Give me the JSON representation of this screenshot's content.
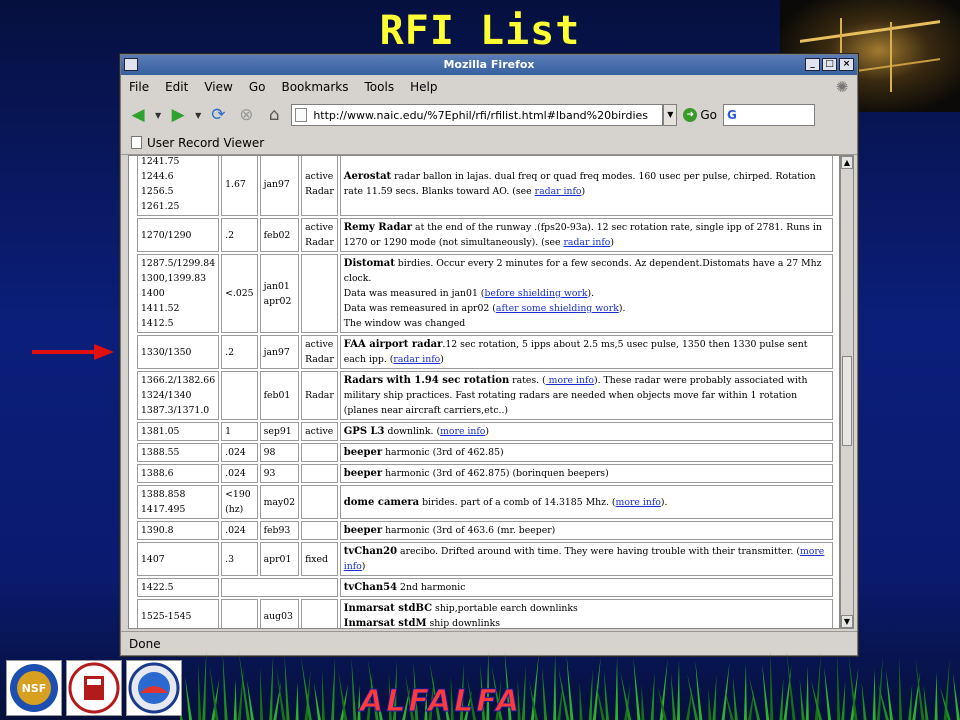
{
  "slide": {
    "title": "RFI List",
    "footer_text": "ALFALFA"
  },
  "window": {
    "title": "Mozilla Firefox"
  },
  "menu": [
    "File",
    "Edit",
    "View",
    "Go",
    "Bookmarks",
    "Tools",
    "Help"
  ],
  "nav": {
    "url": "http://www.naic.edu/%7Ephil/rfi/rfilist.html#lband%20birdies",
    "go_label": "Go",
    "search_value": "G"
  },
  "bookmarks": {
    "item": "User Record Viewer"
  },
  "status": {
    "text": "Done"
  },
  "rows": [
    {
      "freq": [
        "1241.75",
        "1244.6",
        "1256.5",
        "1261.25"
      ],
      "bw": "1.67",
      "date": "jan97",
      "status": [
        "active",
        "Radar"
      ],
      "name": "Aerostat",
      "desc": " radar ballon in lajas. dual freq or quad freq modes. 160 usec per pulse, chirped. Rotation rate 11.59 secs. Blanks toward AO. (see ",
      "link": "radar info",
      "tail": ")"
    },
    {
      "freq": [
        "1270/1290"
      ],
      "bw": ".2",
      "date": "feb02",
      "status": [
        "active",
        "Radar"
      ],
      "name": "Remy Radar",
      "desc": " at the end of the runway .(fps20-93a). 12 sec rotation rate, single ipp of 2781. Runs in 1270 or 1290 mode (not simultaneously). (see ",
      "link": "radar info",
      "tail": ")"
    },
    {
      "freq": [
        "1287.5/1299.84",
        "1300,1399.83",
        "1400",
        "1411.52",
        "1412.5"
      ],
      "bw": "<.025",
      "date": [
        "jan01",
        "apr02"
      ],
      "status": [],
      "name": "Distomat",
      "desc": " birdies. Occur every 2 minutes for a few seconds. Az dependent.Distomats have a 27 Mhz clock.",
      "extra": [
        {
          "pre": "Data was measured in jan01 (",
          "link": "before shielding work",
          "post": ")."
        },
        {
          "pre": "Data was remeasured in apr02 (",
          "link": "after some shielding work",
          "post": ")."
        },
        {
          "pre": "The window was changed",
          "link": "",
          "post": ""
        }
      ]
    },
    {
      "freq": [
        "1330/1350"
      ],
      "bw": ".2",
      "date": "jan97",
      "status": [
        "active",
        "Radar"
      ],
      "name": "FAA airport radar",
      "desc": ".12 sec rotation, 5 ipps about 2.5 ms,5 usec pulse, 1350 then 1330 pulse sent each ipp. (",
      "link": "radar info",
      "tail": ")"
    },
    {
      "freq": [
        "1366.2/1382.66",
        "1324/1340",
        "1387.3/1371.0"
      ],
      "bw": "",
      "date": "feb01",
      "status": [
        "Radar"
      ],
      "name": "Radars with 1.94 sec rotation",
      "desc": " rates. (",
      "link": " more info",
      "tail": "). These radar were probably associated with military ship practices. Fast rotating radars are needed when objects move far within 1 rotation (planes near aircraft carriers,etc..)"
    },
    {
      "freq": [
        "1381.05"
      ],
      "bw": "1",
      "date": "sep91",
      "status": [
        "active"
      ],
      "name": "GPS L3",
      "desc": " downlink. (",
      "link": "more info",
      "tail": ")"
    },
    {
      "freq": [
        "1388.55"
      ],
      "bw": ".024",
      "date": "98",
      "status": [],
      "name": "beeper",
      "desc": " harmonic (3rd of 462.85)",
      "link": "",
      "tail": ""
    },
    {
      "freq": [
        "1388.6"
      ],
      "bw": ".024",
      "date": "93",
      "status": [],
      "name": "beeper",
      "desc": " harmonic (3rd of 462.875) (borinquen beepers)",
      "link": "",
      "tail": ""
    },
    {
      "freq": [
        "1388.858",
        "1417.495"
      ],
      "bw": [
        "<190",
        "(hz)"
      ],
      "date": "may02",
      "status": [],
      "name": "dome camera",
      "desc": " birides. part of a comb of 14.3185 Mhz. (",
      "link": "more info",
      "tail": ")."
    },
    {
      "freq": [
        "1390.8"
      ],
      "bw": ".024",
      "date": "feb93",
      "status": [],
      "name": "beeper",
      "desc": " harmonic (3rd of 463.6 (mr. beeper)",
      "link": "",
      "tail": ""
    },
    {
      "freq": [
        "1407"
      ],
      "bw": ".3",
      "date": "apr01",
      "status": [
        "fixed"
      ],
      "name": "tvChan20",
      "desc": " arecibo. Drifted around with time. They were having trouble with their transmitter. (",
      "link": "more info",
      "tail": ")"
    },
    {
      "freq": [
        "1422.5"
      ],
      "bw": "",
      "date": "",
      "status": [],
      "name": "tvChan54",
      "desc": " 2nd harmonic",
      "link": "",
      "tail": "",
      "merged": true
    },
    {
      "freq": [
        "1525-1545"
      ],
      "bw": "",
      "date": "aug03",
      "status": [],
      "name": "Inmarsat stdBC",
      "desc": " ship,portable earch downlinks",
      "name2": "Inmarsat stdM",
      "desc2": " ship downlinks",
      "link": "",
      "tail": ""
    }
  ]
}
